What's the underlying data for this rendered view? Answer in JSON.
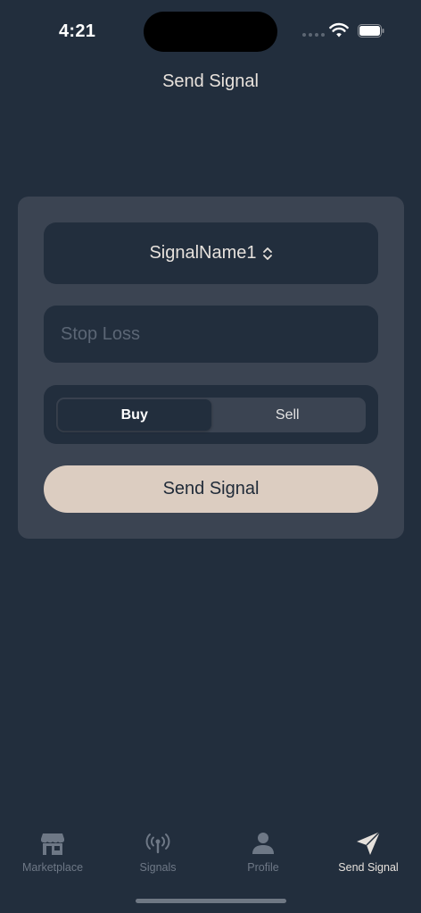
{
  "status_bar": {
    "time": "4:21"
  },
  "header": {
    "title": "Send Signal"
  },
  "form": {
    "signal_picker": {
      "selected": "SignalName1",
      "icon": "chevron-up-down-icon"
    },
    "stop_loss": {
      "value": "",
      "placeholder": "Stop Loss"
    },
    "side_segment": {
      "options": [
        "Buy",
        "Sell"
      ],
      "selected": "Buy"
    },
    "submit_label": "Send Signal"
  },
  "tab_bar": {
    "items": [
      {
        "label": "Marketplace",
        "icon": "storefront-icon",
        "active": false
      },
      {
        "label": "Signals",
        "icon": "antenna-broadcast-icon",
        "active": false
      },
      {
        "label": "Profile",
        "icon": "person-icon",
        "active": false
      },
      {
        "label": "Send Signal",
        "icon": "paper-plane-icon",
        "active": true
      }
    ]
  },
  "colors": {
    "background": "#222e3d",
    "card": "#3b4452",
    "accent_button": "#dccdc1",
    "inactive_tab": "#6e7886",
    "active_tab": "#e6e1dc"
  }
}
